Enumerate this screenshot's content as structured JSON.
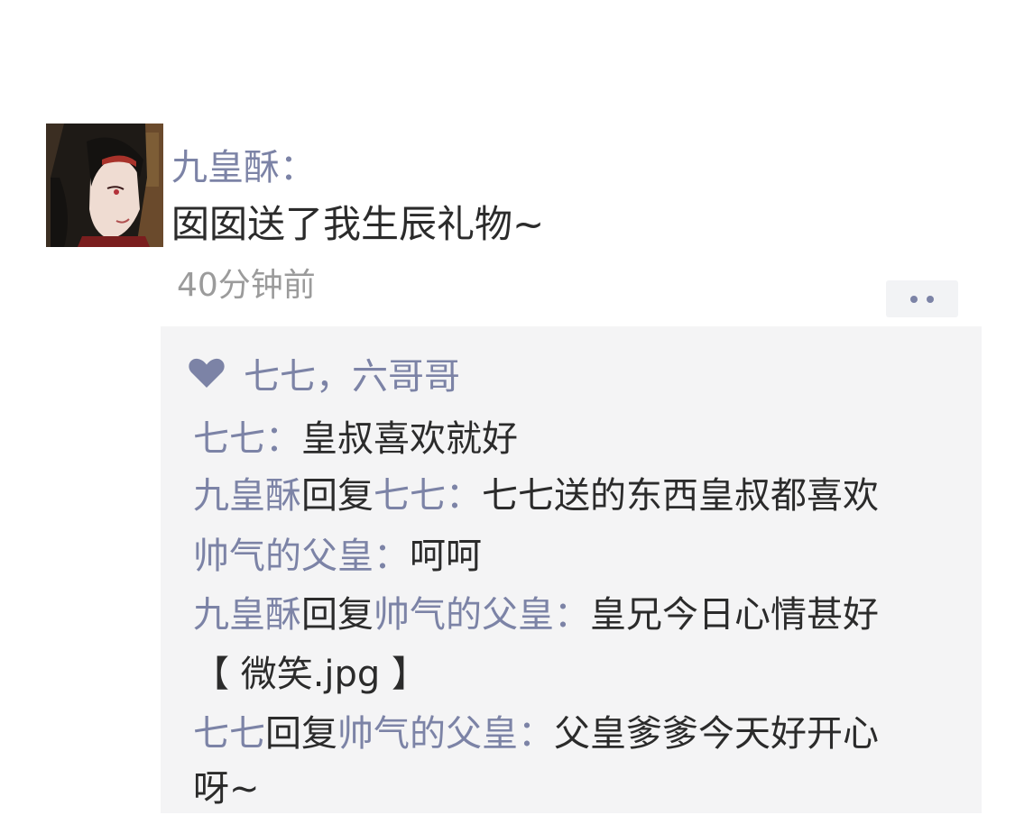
{
  "post": {
    "author": "九皇酥：",
    "text": "囡囡送了我生辰礼物~",
    "time": "40分钟前",
    "more_icon": "more-dots-icon"
  },
  "likes": {
    "icon": "heart-icon",
    "names": "七七，六哥哥"
  },
  "comments": [
    {
      "name": "七七",
      "colon": "：",
      "text": "皇叔喜欢就好"
    },
    {
      "name": "九皇酥",
      "reply_word": "回复",
      "reply_to": "七七",
      "colon": "：",
      "text": "七七送的东西皇叔都喜欢"
    },
    {
      "name": "帅气的父皇",
      "colon": "：",
      "text": "呵呵"
    },
    {
      "name": "九皇酥",
      "reply_word": "回复",
      "reply_to": "帅气的父皇",
      "colon": "：",
      "text": "皇兄今日心情甚好"
    },
    {
      "text": "【 微笑.jpg 】"
    },
    {
      "name": "七七",
      "reply_word": "回复",
      "reply_to": "帅气的父皇",
      "colon": "：",
      "text": "父皇爹爹今天好开心"
    },
    {
      "text": "呀~"
    }
  ],
  "colors": {
    "name_color": "#7c83a6",
    "text_color": "#2b2b2b",
    "time_color": "#9b9b9b",
    "panel_bg": "#f4f4f5"
  }
}
